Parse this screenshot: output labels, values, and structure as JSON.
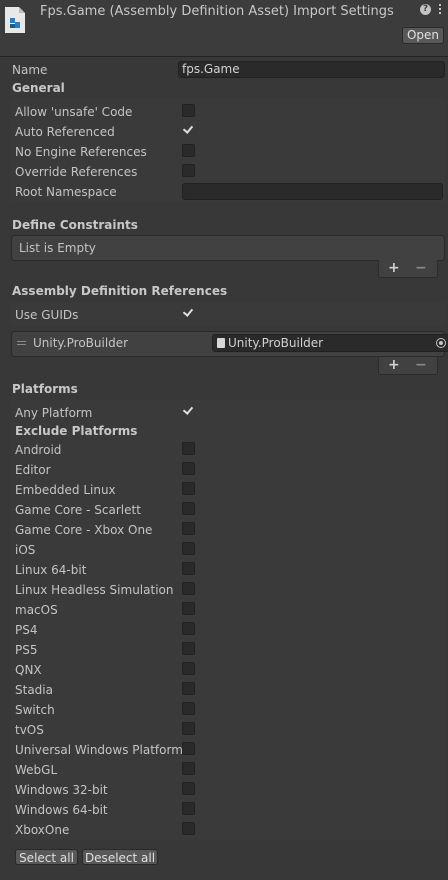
{
  "header": {
    "title": "Fps.Game (Assembly Definition Asset) Import Settings",
    "help_icon": "help-icon",
    "menu_icon": "kebab-menu-icon",
    "open_label": "Open"
  },
  "name": {
    "label": "Name",
    "value": "fps.Game"
  },
  "general": {
    "heading": "General",
    "allow_unsafe": {
      "label": "Allow 'unsafe' Code",
      "checked": false
    },
    "auto_referenced": {
      "label": "Auto Referenced",
      "checked": true
    },
    "no_engine_refs": {
      "label": "No Engine References",
      "checked": false
    },
    "override_refs": {
      "label": "Override References",
      "checked": false
    },
    "root_namespace": {
      "label": "Root Namespace",
      "value": ""
    }
  },
  "define_constraints": {
    "heading": "Define Constraints",
    "empty_text": "List is Empty",
    "add": "+",
    "remove": "−"
  },
  "assembly_refs": {
    "heading": "Assembly Definition References",
    "use_guids": {
      "label": "Use GUIDs",
      "checked": true
    },
    "items": [
      {
        "label": "Unity.ProBuilder",
        "value": "Unity.ProBuilder"
      }
    ],
    "add": "+",
    "remove": "−"
  },
  "platforms": {
    "heading": "Platforms",
    "any_platform": {
      "label": "Any Platform",
      "checked": true
    },
    "exclude_heading": "Exclude Platforms",
    "list": [
      "Android",
      "Editor",
      "Embedded Linux",
      "Game Core - Scarlett",
      "Game Core - Xbox One",
      "iOS",
      "Linux 64-bit",
      "Linux Headless Simulation",
      "macOS",
      "PS4",
      "PS5",
      "QNX",
      "Stadia",
      "Switch",
      "tvOS",
      "Universal Windows Platform",
      "WebGL",
      "Windows 32-bit",
      "Windows 64-bit",
      "XboxOne"
    ],
    "select_all": "Select all",
    "deselect_all": "Deselect all"
  }
}
